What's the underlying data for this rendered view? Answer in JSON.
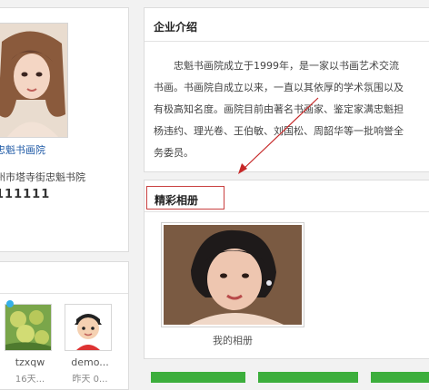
{
  "profile": {
    "company_name": "忠魁书画院",
    "address": "州市塔寺街忠魁书院",
    "phone": "111111",
    "link_fragment": "·"
  },
  "friends": [
    {
      "name": "tzxqw",
      "meta": "16天..."
    },
    {
      "name": "demo...",
      "meta": "昨天 0..."
    }
  ],
  "intro": {
    "title": "企业介绍",
    "lines": [
      "忠魁书画院成立于1999年，是一家以书画艺术交流",
      "书画。书画院自成立以来，一直以其依厚的学术氛围以及",
      "有极高知名度。画院目前由著名书画家、鉴定家满忠魁担",
      "杨违约、理光卷、王伯敏、刘国松、周韶华等一批响誉全",
      "务委员。"
    ]
  },
  "album": {
    "title": "精彩相册",
    "caption": "我的相册"
  },
  "colors": {
    "link": "#1f5aa6",
    "highlight_border": "#c94040",
    "arrow": "#c62828",
    "button_green": "#3cae3c"
  }
}
